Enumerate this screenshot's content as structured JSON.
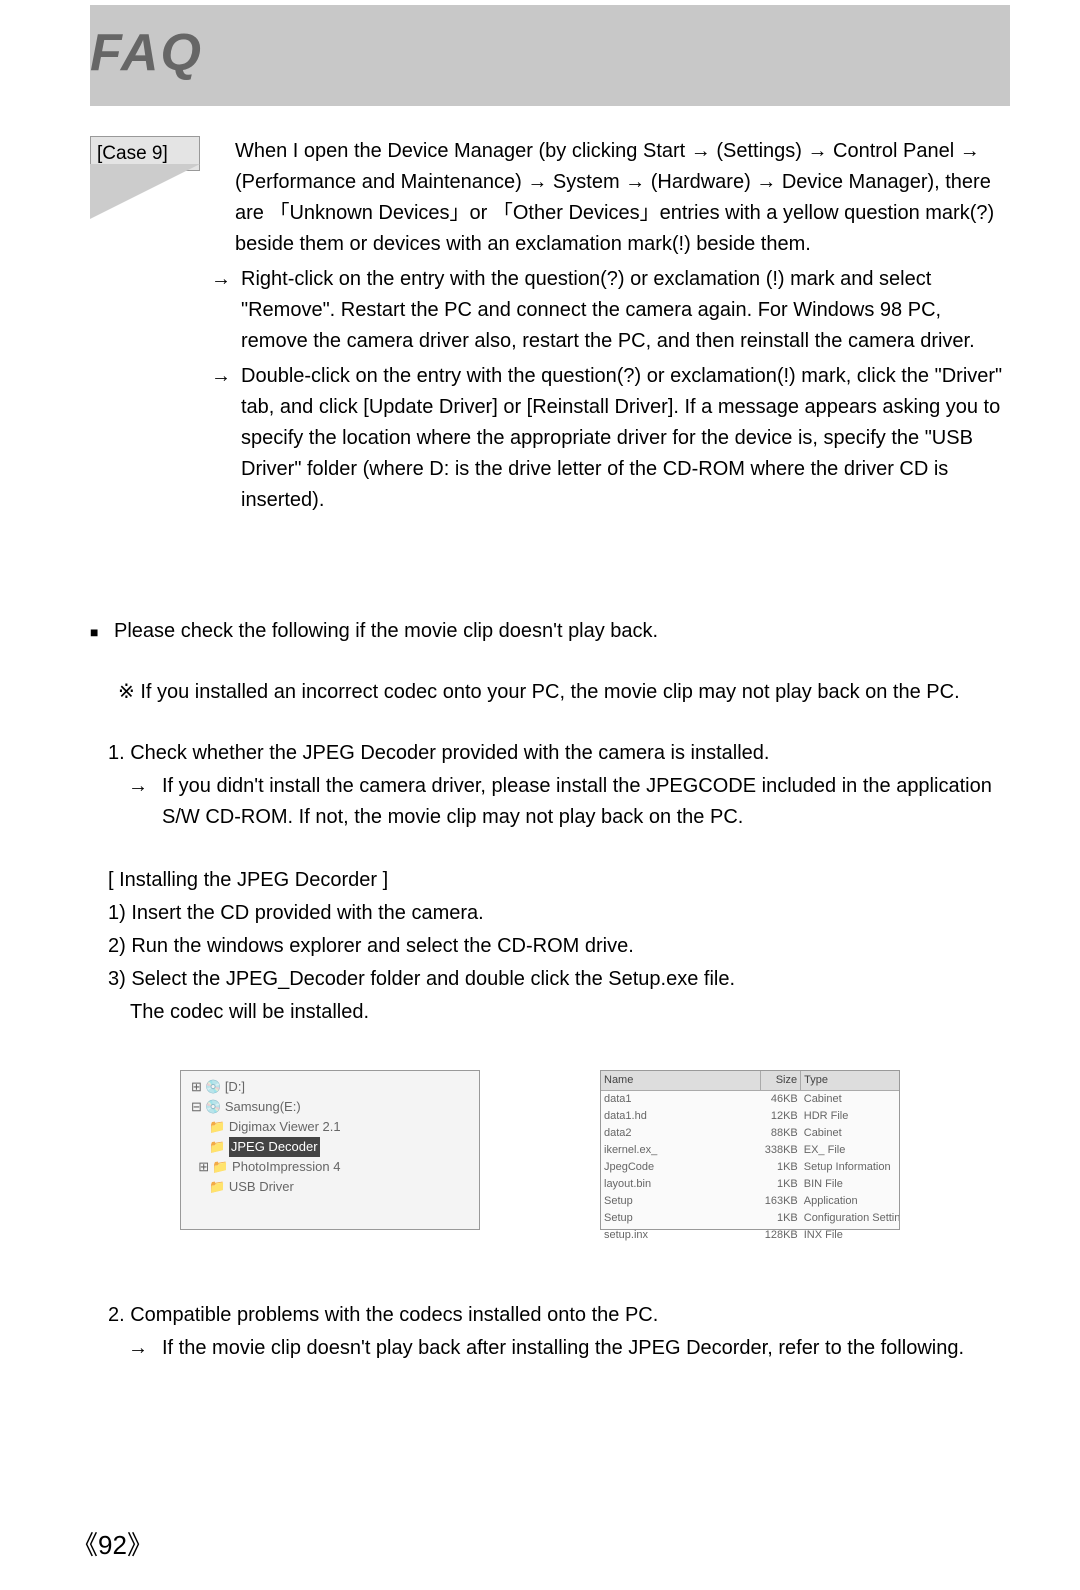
{
  "header": {
    "title": "FAQ"
  },
  "case": {
    "label": "[Case 9]",
    "intro": "When I open the Device Manager (by clicking Start → (Settings) → Control Panel → (Performance and Maintenance) → System → (Hardware) → Device Manager), there are 「Unknown Devices」or 「Other Devices」entries with a yellow question mark(?) beside them or devices with an exclamation mark(!) beside them.",
    "bullets": [
      "Right-click on the entry with the question(?) or exclamation (!) mark and select \"Remove\". Restart the PC and connect the camera again. For Windows 98 PC, remove the camera driver also, restart the PC, and then reinstall the camera driver.",
      "Double-click on the entry with the question(?) or exclamation(!) mark, click the \"Driver\" tab, and click [Update Driver] or [Reinstall Driver]. If a message appears asking you to specify the location where the appropriate driver for the device is, specify the \"USB Driver\" folder (where D: is the drive letter of the CD-ROM where the driver CD is inserted)."
    ]
  },
  "movie": {
    "lead": "Please check the following if the movie clip doesn't play back.",
    "note": "If you installed an incorrect codec onto your PC, the movie clip may not play back on the PC.",
    "step1": {
      "num": "1. Check whether the JPEG Decoder provided with the camera is installed.",
      "arrow": "If you didn't install the camera driver, please install the JPEGCODE included in the application S/W CD-ROM. If not, the movie clip may not play back on the PC."
    },
    "install": {
      "title": "[ Installing the JPEG Decorder ]",
      "s1": "1) Insert the CD provided with the camera.",
      "s2": "2) Run the windows explorer and select the CD-ROM drive.",
      "s3": "3) Select the JPEG_Decoder folder and double click the Setup.exe file.",
      "s3b": "The codec will be installed."
    },
    "step2": {
      "num": "2. Compatible problems with the codecs installed onto the PC.",
      "arrow": "If the movie clip doesn't play back after installing the JPEG Decorder, refer to the following."
    }
  },
  "figures": {
    "tree": {
      "root": "[D:]",
      "drive": "Samsung(E:)",
      "items": [
        "Digimax Viewer 2.1",
        "JPEG Decoder",
        "PhotoImpression 4",
        "USB Driver"
      ],
      "selectedIndex": 1
    },
    "list": {
      "headers": [
        "Name",
        "Size",
        "Type"
      ],
      "rows": [
        [
          "data1",
          "46KB",
          "Cabinet"
        ],
        [
          "data1.hd",
          "12KB",
          "HDR File"
        ],
        [
          "data2",
          "88KB",
          "Cabinet"
        ],
        [
          "ikernel.ex_",
          "338KB",
          "EX_ File"
        ],
        [
          "JpegCode",
          "1KB",
          "Setup Information"
        ],
        [
          "layout.bin",
          "1KB",
          "BIN File"
        ],
        [
          "Setup",
          "163KB",
          "Application"
        ],
        [
          "Setup",
          "1KB",
          "Configuration Settings"
        ],
        [
          "setup.inx",
          "128KB",
          "INX File"
        ]
      ]
    }
  },
  "pagenum": "92",
  "glyphs": {
    "arrow": "→",
    "square": "■",
    "star": "※"
  }
}
